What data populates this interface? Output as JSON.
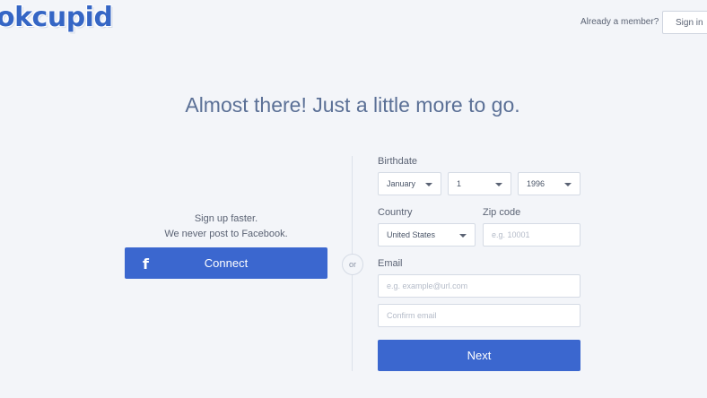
{
  "header": {
    "logo": "okcupid",
    "already_member": "Already a member?",
    "sign_in": "Sign in"
  },
  "headline": "Almost there! Just a little more to go.",
  "facebook": {
    "line1": "Sign up faster.",
    "line2": "We never post to Facebook.",
    "icon": "f",
    "connect_label": "Connect"
  },
  "divider": {
    "or": "or"
  },
  "form": {
    "birthdate_label": "Birthdate",
    "month": "January",
    "day": "1",
    "year": "1996",
    "country_label": "Country",
    "country": "United States",
    "zip_label": "Zip code",
    "zip_placeholder": "e.g. 10001",
    "email_label": "Email",
    "email_placeholder": "e.g. example@url.com",
    "confirm_placeholder": "Confirm email",
    "next_label": "Next"
  },
  "colors": {
    "primary": "#3b67cf",
    "headline": "#5b7096",
    "background": "#f3f5f9"
  }
}
